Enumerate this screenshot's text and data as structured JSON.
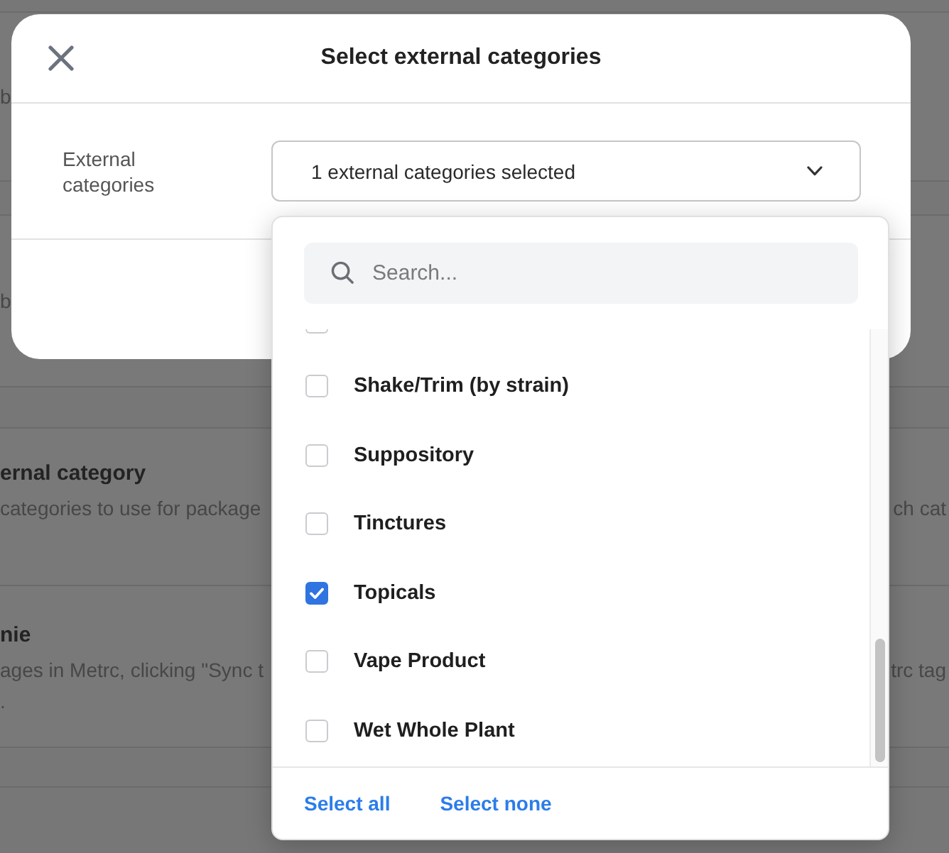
{
  "background_page": {
    "sections": [
      {
        "lines": [
          "b"
        ]
      },
      {
        "lines": [
          "b"
        ]
      },
      {
        "title": "ernal category",
        "lines": [
          "categories to use for package"
        ],
        "side_text": "ch cat"
      },
      {
        "title": "nie",
        "lines": [
          "ages in Metrc, clicking \"Sync t",
          "."
        ],
        "side_text": "trc tag"
      }
    ]
  },
  "dialog": {
    "title": "Select external categories",
    "field_label": "External categories",
    "select": {
      "value": "1 external categories selected"
    }
  },
  "dropdown": {
    "search": {
      "placeholder": "Search..."
    },
    "options": [
      {
        "checked": false
      },
      {
        "label": "Shake/Trim (by strain)",
        "checked": false
      },
      {
        "label": "Suppository",
        "checked": false
      },
      {
        "label": "Tinctures",
        "checked": false
      },
      {
        "label": "Topicals",
        "checked": true
      },
      {
        "label": "Vape Product",
        "checked": false
      },
      {
        "label": "Wet Whole Plant",
        "checked": false
      }
    ],
    "actions": [
      "Select all",
      "Select none"
    ]
  }
}
